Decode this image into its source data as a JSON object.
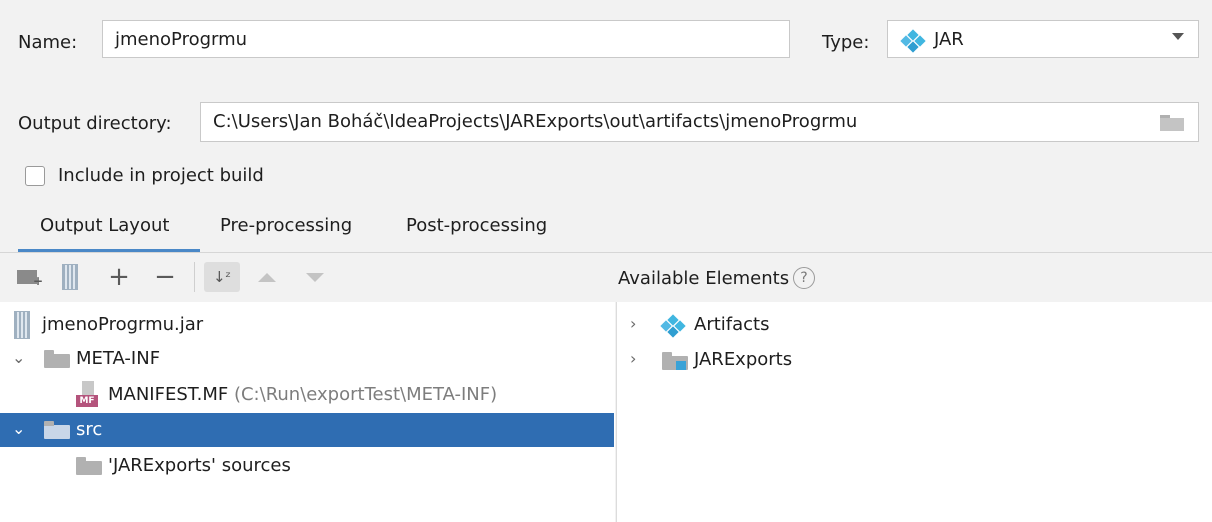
{
  "name_field": {
    "label": "Name:",
    "value": "jmenoProgrmu"
  },
  "type_field": {
    "label": "Type:",
    "value": "JAR",
    "icon": "artifact-diamond-icon"
  },
  "output_directory": {
    "label": "Output directory:",
    "value": "C:\\Users\\Jan Boháč\\IdeaProjects\\JARExports\\out\\artifacts\\jmenoProgrmu",
    "icon": "folder-open-icon"
  },
  "include_build": {
    "label": "Include in project build",
    "checked": false
  },
  "tabs": [
    {
      "label": "Output Layout",
      "active": true
    },
    {
      "label": "Pre-processing",
      "active": false
    },
    {
      "label": "Post-processing",
      "active": false
    }
  ],
  "toolbar": {
    "icons": [
      "create-directory-icon",
      "jar-icon",
      "add-icon",
      "remove-icon",
      "sort-icon",
      "move-up-icon",
      "move-down-icon"
    ]
  },
  "left_tree": [
    {
      "label": "jmenoProgrmu.jar",
      "hint": "",
      "icon": "jar-icon",
      "expanded": null,
      "selected": false
    },
    {
      "label": "META-INF",
      "hint": "",
      "icon": "folder-icon",
      "expanded": true,
      "selected": false
    },
    {
      "label": "MANIFEST.MF",
      "hint": "(C:\\Run\\exportTest\\META-INF)",
      "icon": "manifest-icon",
      "expanded": null,
      "selected": false
    },
    {
      "label": "src",
      "hint": "",
      "icon": "folder-icon",
      "expanded": true,
      "selected": true
    },
    {
      "label": "'JARExports' sources",
      "hint": "",
      "icon": "folder-icon",
      "expanded": null,
      "selected": false
    }
  ],
  "available": {
    "title": "Available Elements",
    "help_icon": "help-icon",
    "items": [
      {
        "label": "Artifacts",
        "icon": "artifacts-icon"
      },
      {
        "label": "JARExports",
        "icon": "module-folder-icon"
      }
    ]
  },
  "colors": {
    "selection": "#2f6db2",
    "accent": "#4a88c7",
    "background": "#f2f2f2"
  }
}
